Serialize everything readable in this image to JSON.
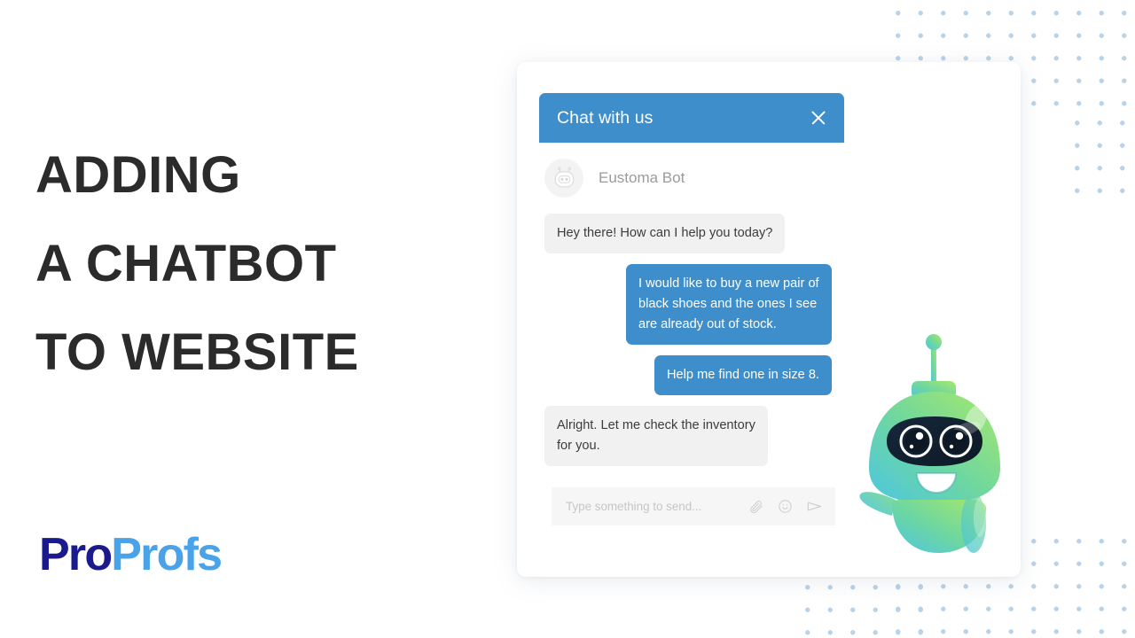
{
  "headline": {
    "lines": [
      "ADDING",
      "A CHATBOT",
      "TO WEBSITE"
    ]
  },
  "logo": {
    "part1": "Pro",
    "part2": "Profs",
    "color1": "#1a1a8c",
    "color2": "#4aa3e8"
  },
  "chat_widget": {
    "header": {
      "title": "Chat with us",
      "close_icon": "close-icon",
      "background_color": "#3d8ecb",
      "title_color": "#ffffff"
    },
    "bot": {
      "name": "Eustoma Bot",
      "avatar_icon": "robot-head-icon",
      "name_color": "#9b9b9b"
    },
    "messages": [
      {
        "sender": "bot",
        "text": "Hey there! How can I help you today?",
        "background_color": "#f1f1f1",
        "text_color": "#3c3c3c"
      },
      {
        "sender": "user",
        "text": "I would like to buy a new pair of black shoes and the ones I see are already out of stock.",
        "background_color": "#3d8ecb",
        "text_color": "#ffffff"
      },
      {
        "sender": "user",
        "text": "Help me find one in size 8.",
        "background_color": "#3d8ecb",
        "text_color": "#ffffff"
      },
      {
        "sender": "bot",
        "text": "Alright. Let me check the inventory for you.",
        "background_color": "#f1f1f1",
        "text_color": "#3c3c3c"
      }
    ],
    "composer": {
      "placeholder": "Type something to send...",
      "value": "",
      "icons": [
        "attachment-icon",
        "emoji-icon",
        "send-icon"
      ]
    }
  },
  "mascot": {
    "name": "chatbot-robot-mascot",
    "gradient_start": "#7de06a",
    "gradient_end": "#4fc4e0",
    "visor_color": "#122031"
  },
  "decoration": {
    "dot_color": "#b9d3ea"
  }
}
